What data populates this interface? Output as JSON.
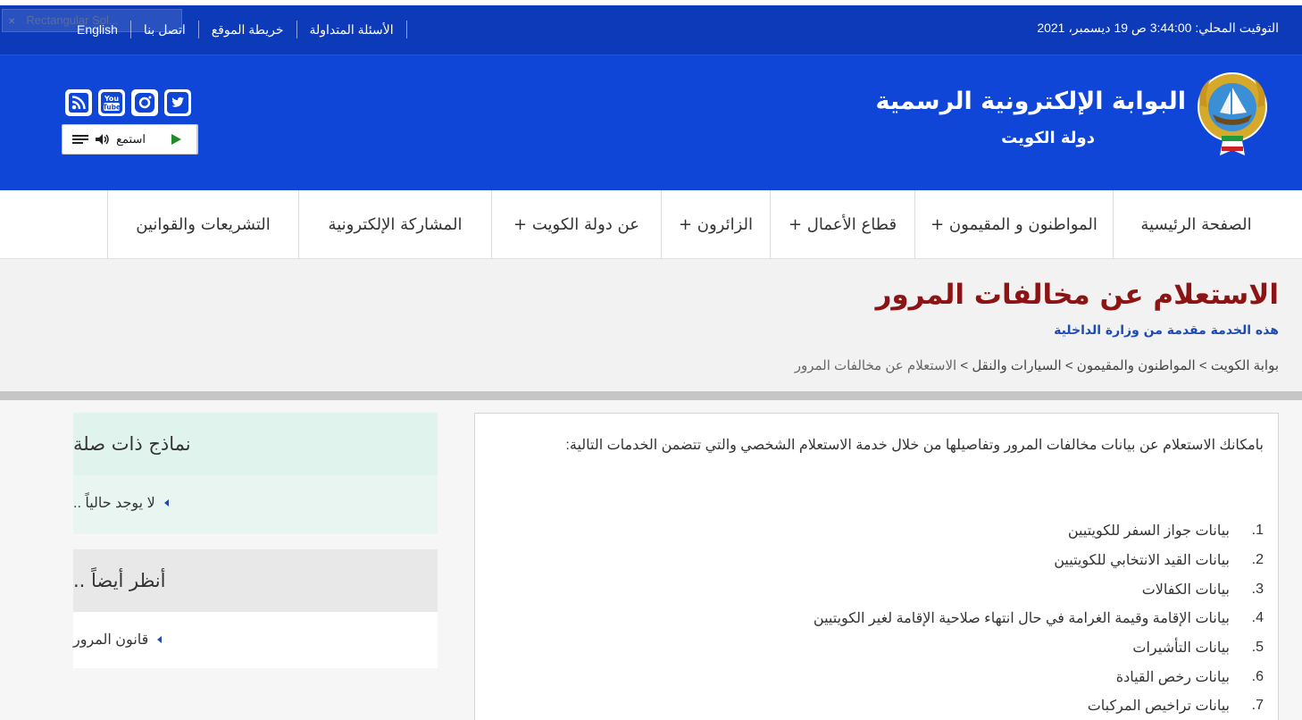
{
  "browser": {
    "broken_image_alt": "Rectangular Sol..."
  },
  "topbar": {
    "local_time": "التوقيت المحلي: 3:44:00 ص 19 ديسمبر، 2021",
    "links": [
      "English",
      "اتصل بنا",
      "خريطة الموقع",
      "الأسئلة المتداولة"
    ]
  },
  "header": {
    "title": "البوابة الإلكترونية الرسمية",
    "subtitle": "دولة الكويت",
    "listen_label": "استمع",
    "socials": [
      "twitter-icon",
      "instagram-icon",
      "youtube-icon",
      "rss-icon"
    ],
    "youtube_text_1": "You",
    "youtube_text_2": "Tube"
  },
  "nav": {
    "items": [
      "الصفحة الرئيسية",
      "المواطنون و المقيمون +",
      "قطاع الأعمال +",
      "الزائرون +",
      "عن دولة الكويت +",
      "المشاركة الإلكترونية",
      "التشريعات والقوانين"
    ]
  },
  "page": {
    "title": "الاستعلام عن مخالفات المرور",
    "service_by": "هذه الخدمة مقدمة من وزارة الداخلية",
    "breadcrumb": [
      "بوابة الكويت",
      "المواطنون والمقيمون",
      "السيارات والنقل",
      "الاستعلام عن مخالفات المرور"
    ],
    "breadcrumb_sep": ">"
  },
  "content": {
    "intro": "بامكانك الاستعلام عن بيانات مخالفات المرور وتفاصيلها من خلال خدمة الاستعلام الشخصي والتي تتضمن الخدمات التالية:",
    "services": [
      {
        "num": "1.",
        "text": "بيانات جواز السفر للكويتيين"
      },
      {
        "num": "2.",
        "text": "بيانات القيد الانتخابي للكويتيين"
      },
      {
        "num": "3.",
        "text": "بيانات الكفالات"
      },
      {
        "num": "4.",
        "text": "بيانات الإقامة وقيمة الغرامة في حال انتهاء صلاحية الإقامة لغير الكويتيين"
      },
      {
        "num": "5.",
        "text": "بيانات التأشيرات"
      },
      {
        "num": "6.",
        "text": "بيانات رخص القيادة"
      },
      {
        "num": "7.",
        "text": "بيانات تراخيص المركبات"
      }
    ]
  },
  "sidebar": {
    "related_title": "نماذج ذات صلة",
    "related_items": [
      "لا يوجد حالياً .."
    ],
    "see_also_title": "أنظر أيضاً ..",
    "see_also_items": [
      "قانون المرور"
    ]
  },
  "colors": {
    "topbar": "#0c3ab8",
    "header": "#1046d8",
    "title": "#8c1414",
    "accent_blue": "#1d4bb6"
  }
}
